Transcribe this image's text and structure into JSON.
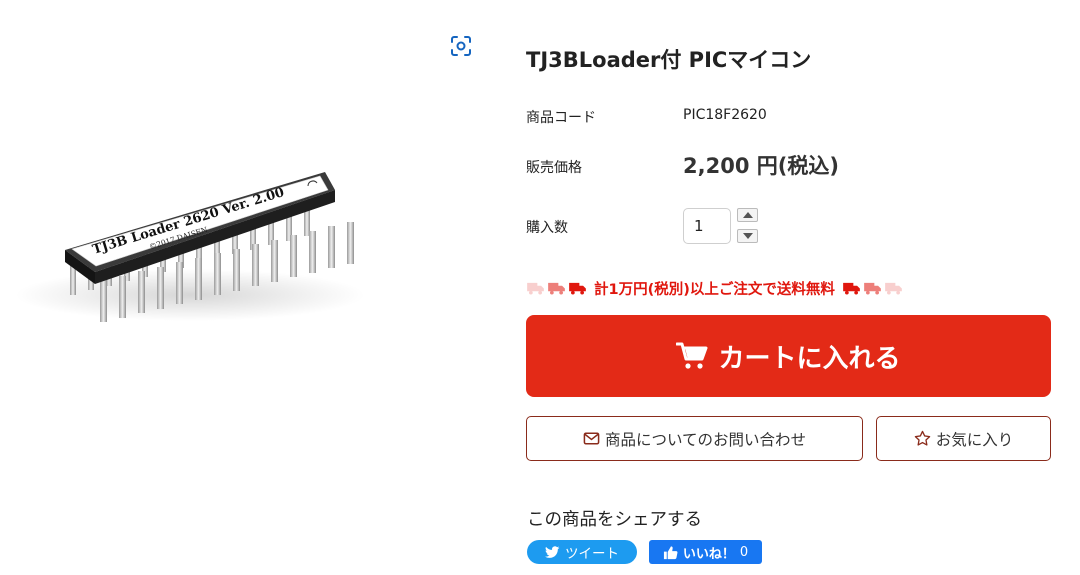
{
  "product": {
    "title": "TJ3BLoader付 PICマイコン",
    "image": {
      "label_line1": "TJ3B Loader 2620 Ver. 2.00",
      "label_line2": "©2017 DAISEN"
    }
  },
  "details": {
    "code_label": "商品コード",
    "code_value": "PIC18F2620",
    "price_label": "販売価格",
    "price_value": "2,200 円(税込)",
    "quantity_label": "購入数",
    "quantity_value": "1"
  },
  "shipping_notice": {
    "text": "計1万円(税別)以上ご注文で送料無料",
    "accent_color": "#e0170e"
  },
  "actions": {
    "add_to_cart": "カートに入れる",
    "inquiry": "商品についてのお問い合わせ",
    "favorite": "お気に入り",
    "cart_color": "#e32a17"
  },
  "share": {
    "title": "この商品をシェアする",
    "tweet_label": "ツイート",
    "like_label": "いいね！",
    "like_count": "0"
  },
  "icons": {
    "zoom": "zoom-scan-icon",
    "truck": "truck-icon",
    "cart": "cart-icon",
    "mail": "envelope-icon",
    "star": "star-outline-icon",
    "twitter": "twitter-bird-icon",
    "like": "thumbs-up-icon"
  }
}
